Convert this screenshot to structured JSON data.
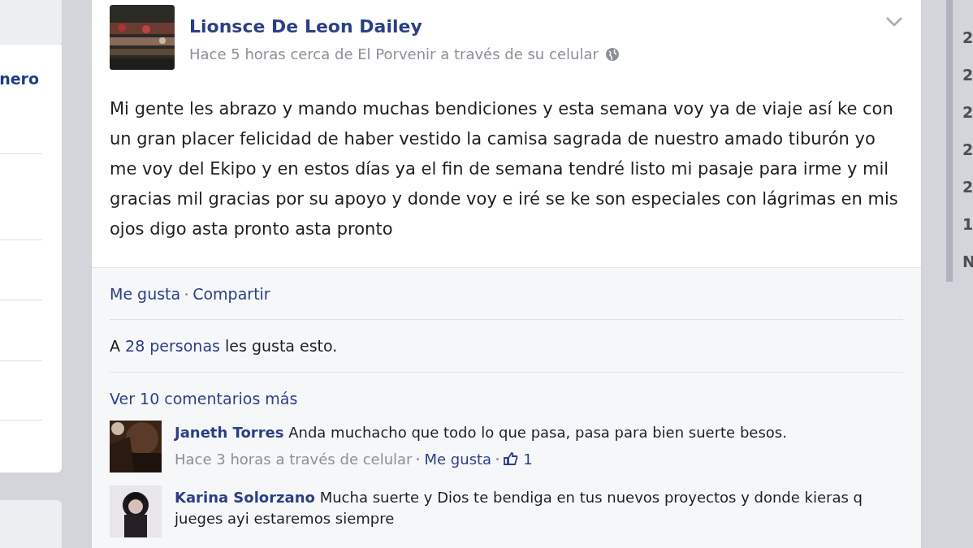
{
  "left_panel": {
    "link": "nero"
  },
  "post": {
    "author": "Lionsce De Leon Dailey",
    "meta": "Hace 5 horas cerca de El Porvenir a través de su celular",
    "text": "Mi gente les abrazo y mando muchas bendiciones y esta semana voy ya de viaje así ke con un gran placer felicidad de haber vestido la camisa sagrada de nuestro amado tiburón yo me voy del Ekipo y en estos días ya el fin de semana tendré listo mi pasaje para irme y mil gracias mil gracias por su apoyo y donde voy e iré se ke son especiales con lágrimas en mis ojos digo asta pronto asta pronto",
    "actions": [
      "Me gusta",
      "Compartir"
    ],
    "likes": {
      "prefix": "A",
      "link": "28 personas",
      "suffix": "les gusta esto."
    },
    "more_comments": "Ver 10 comentarios más",
    "comments": [
      {
        "author": "Janeth Torres",
        "text": "Anda muchacho que todo lo que pasa, pasa para bien suerte besos.",
        "meta": "Hace 3 horas a través de celular",
        "like": "Me gusta",
        "like_count": "1"
      },
      {
        "author": "Karina Solorzano",
        "text": "Mucha suerte y Dios te bendiga en tus nuevos proyectos y donde kieras q jueges ayi estaremos siempre"
      }
    ]
  },
  "right_column": [
    "2",
    "2",
    "2",
    "2",
    "2",
    "1",
    "N"
  ]
}
